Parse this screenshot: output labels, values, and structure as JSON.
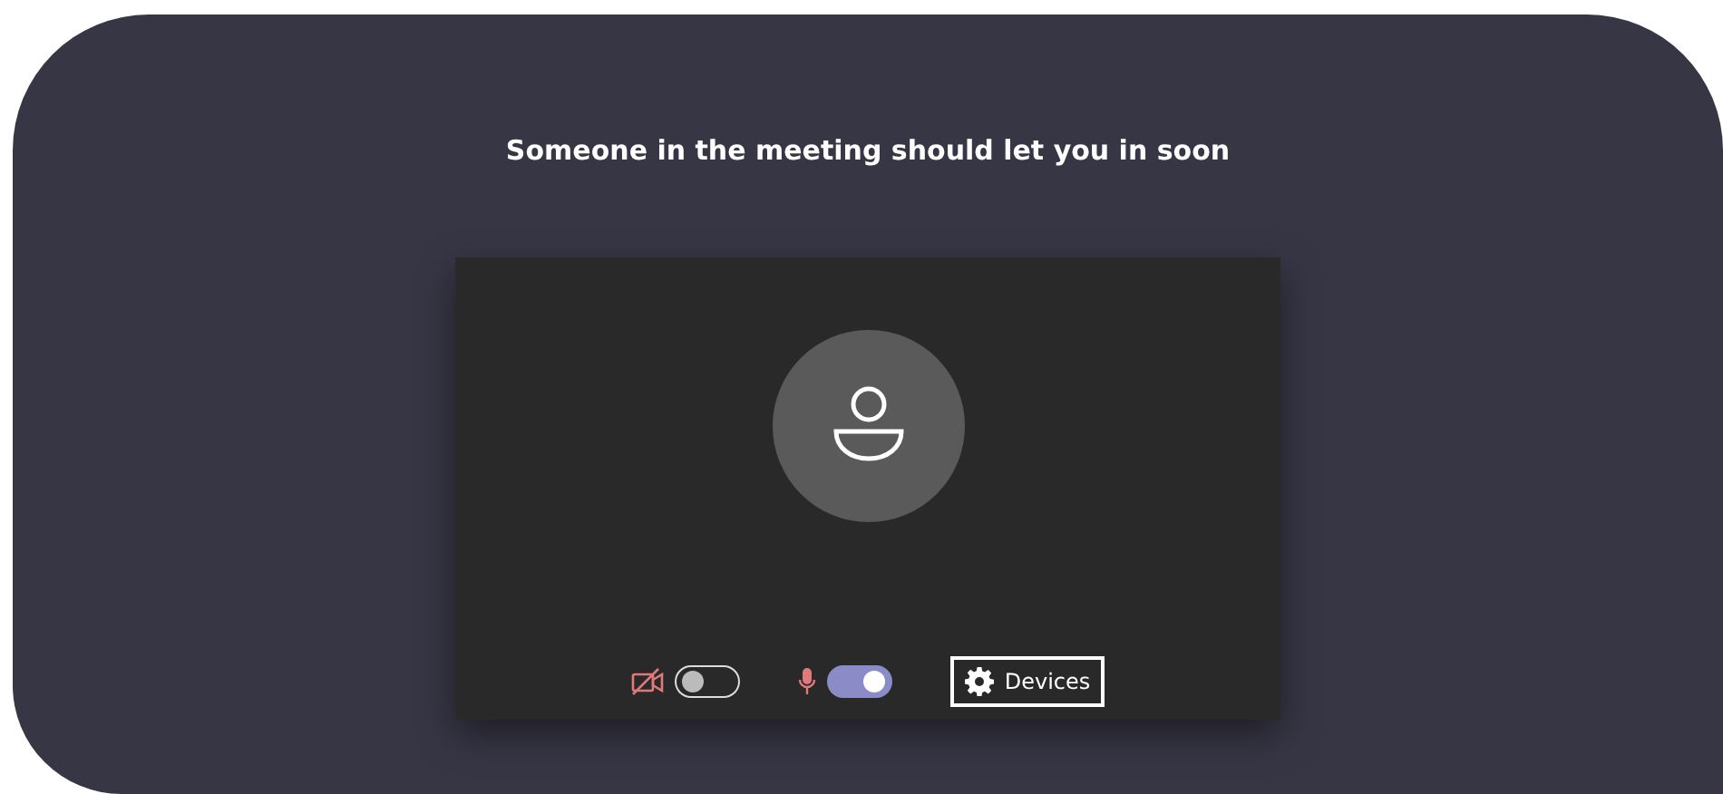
{
  "message": "Someone in the meeting should let you in soon",
  "preview": {
    "camera": {
      "on": false
    },
    "microphone": {
      "on": true
    },
    "devices_button": {
      "label": "Devices",
      "focused": true
    }
  }
}
